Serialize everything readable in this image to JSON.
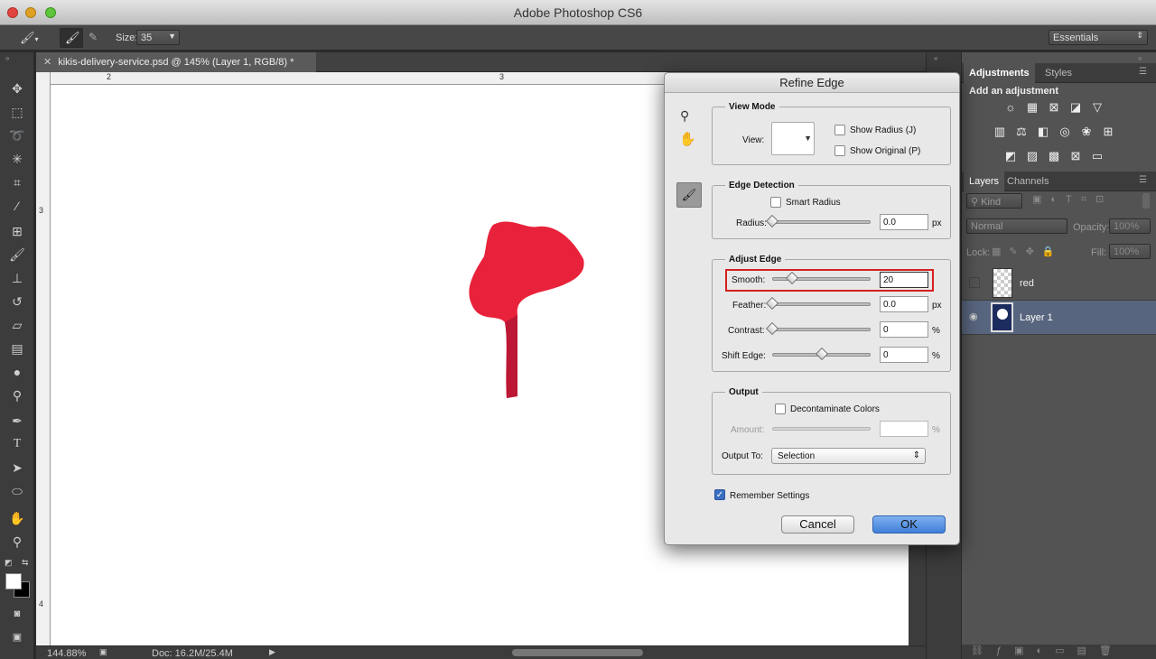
{
  "app": {
    "title": "Adobe Photoshop CS6"
  },
  "options_bar": {
    "size_label": "Size:",
    "size_value": "35",
    "workspace": "Essentials"
  },
  "document": {
    "tab_title": "kikis-delivery-service.psd @ 145% (Layer 1, RGB/8) *",
    "ruler_h": [
      "2",
      "3"
    ],
    "ruler_v": [
      "3",
      "4"
    ],
    "zoom": "144.88%",
    "doc_size": "Doc: 16.2M/25.4M"
  },
  "panels": {
    "adjustments_tab": "Adjustments",
    "styles_tab": "Styles",
    "add_adjustment": "Add an adjustment",
    "layers_tab": "Layers",
    "channels_tab": "Channels",
    "kind": "Kind",
    "blend_mode": "Normal",
    "opacity_label": "Opacity:",
    "opacity_value": "100%",
    "lock_label": "Lock:",
    "fill_label": "Fill:",
    "fill_value": "100%",
    "layers": [
      {
        "name": "red",
        "visible": false
      },
      {
        "name": "Layer 1",
        "visible": true,
        "selected": true
      }
    ]
  },
  "dialog": {
    "title": "Refine Edge",
    "view_mode": {
      "legend": "View Mode",
      "view_label": "View:",
      "show_radius": "Show Radius (J)",
      "show_original": "Show Original (P)"
    },
    "edge_detection": {
      "legend": "Edge Detection",
      "smart_radius": "Smart Radius",
      "radius_label": "Radius:",
      "radius_value": "0.0",
      "radius_unit": "px"
    },
    "adjust_edge": {
      "legend": "Adjust Edge",
      "smooth_label": "Smooth:",
      "smooth_value": "20",
      "feather_label": "Feather:",
      "feather_value": "0.0",
      "feather_unit": "px",
      "contrast_label": "Contrast:",
      "contrast_value": "0",
      "contrast_unit": "%",
      "shift_label": "Shift Edge:",
      "shift_value": "0",
      "shift_unit": "%"
    },
    "output": {
      "legend": "Output",
      "decontaminate": "Decontaminate Colors",
      "amount_label": "Amount:",
      "amount_value": "",
      "amount_unit": "%",
      "output_to_label": "Output To:",
      "output_to_value": "Selection"
    },
    "remember_settings": "Remember Settings",
    "cancel": "Cancel",
    "ok": "OK"
  },
  "colors": {
    "highlight": "#d62020",
    "selection_red": "#e8223a",
    "ok_button": "#4a86dc"
  }
}
